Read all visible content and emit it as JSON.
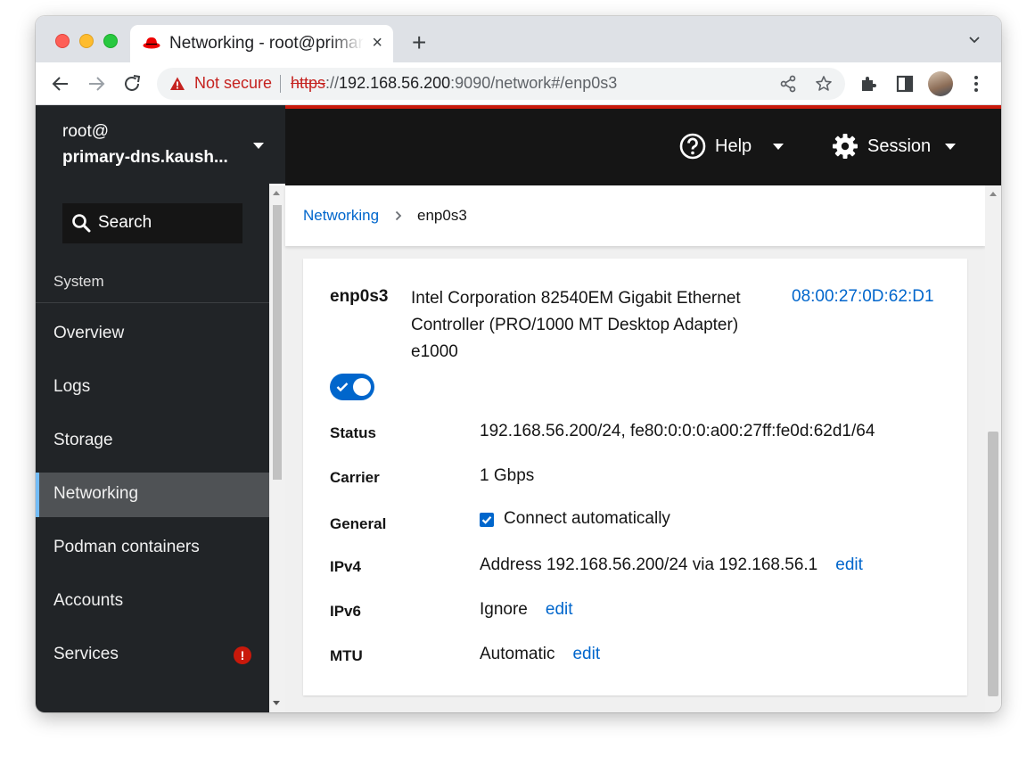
{
  "browser": {
    "tab_title": "Networking - root@primary-dns.kaushal.local",
    "tab_close": "×",
    "new_tab": "+",
    "not_secure": "Not secure",
    "url_scheme": "https",
    "url_host": "192.168.56.200",
    "url_rest": ":9090/network#/enp0s3"
  },
  "header": {
    "host_user": "root@",
    "host_name": "primary-dns.kaush...",
    "help_label": "Help",
    "session_label": "Session"
  },
  "sidebar": {
    "search_label": "Search",
    "section": "System",
    "items": [
      {
        "label": "Overview",
        "active": false
      },
      {
        "label": "Logs",
        "active": false
      },
      {
        "label": "Storage",
        "active": false
      },
      {
        "label": "Networking",
        "active": true
      },
      {
        "label": "Podman containers",
        "active": false
      },
      {
        "label": "Accounts",
        "active": false
      },
      {
        "label": "Services",
        "active": false,
        "badge": "!"
      }
    ]
  },
  "breadcrumb": {
    "parent": "Networking",
    "current": "enp0s3"
  },
  "interface": {
    "name": "enp0s3",
    "description": "Intel Corporation 82540EM Gigabit Ethernet Controller (PRO/1000 MT Desktop Adapter) e1000",
    "mac": "08:00:27:0D:62:D1",
    "enabled": true,
    "rows": {
      "status_label": "Status",
      "status_value": "192.168.56.200/24, fe80:0:0:0:a00:27ff:fe0d:62d1/64",
      "carrier_label": "Carrier",
      "carrier_value": "1 Gbps",
      "general_label": "General",
      "general_value": "Connect automatically",
      "ipv4_label": "IPv4",
      "ipv4_value": "Address 192.168.56.200/24 via 192.168.56.1",
      "ipv6_label": "IPv6",
      "ipv6_value": "Ignore",
      "mtu_label": "MTU",
      "mtu_value": "Automatic",
      "edit_label": "edit"
    }
  },
  "colors": {
    "accent": "#0066cc",
    "sidebar_bg": "#212427",
    "topbar_bg": "#151515",
    "brand_red": "#c9190b",
    "active_indicator": "#73bcf7"
  },
  "icons": [
    "redhat-favicon-icon",
    "close-icon",
    "plus-icon",
    "chevron-down-icon",
    "back-arrow-icon",
    "forward-arrow-icon",
    "reload-icon",
    "warning-icon",
    "share-icon",
    "star-icon",
    "extensions-icon",
    "side-panel-icon",
    "avatar",
    "kebab-menu-icon",
    "search-icon",
    "help-icon",
    "gear-icon",
    "caret-down-icon",
    "check-icon",
    "exclamation-icon"
  ]
}
